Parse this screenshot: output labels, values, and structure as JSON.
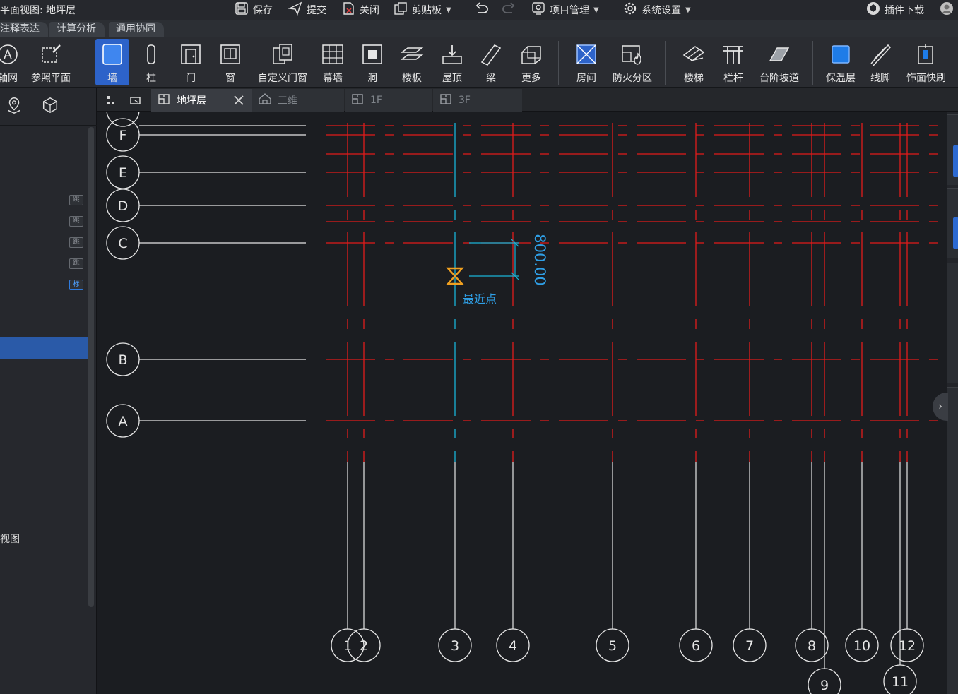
{
  "titlebar": {
    "title": "平面视图: 地坪层",
    "actions": [
      {
        "label": "保存",
        "icon": "save-icon"
      },
      {
        "label": "提交",
        "icon": "submit-icon"
      },
      {
        "label": "关闭",
        "icon": "close-file-icon"
      },
      {
        "label": "剪贴板",
        "icon": "clipboard-icon"
      },
      {
        "label": "项目管理",
        "icon": "project-settings-icon"
      },
      {
        "label": "系统设置",
        "icon": "system-settings-icon"
      },
      {
        "label": "插件下载",
        "icon": "plugin-download-icon"
      }
    ]
  },
  "ribbon_tabs": [
    "注释表达",
    "计算分析",
    "通用协同"
  ],
  "ribbon_tools": [
    {
      "label": "轴网",
      "icon": "axis-grid-icon"
    },
    {
      "label": "参照平面",
      "icon": "reference-plane-icon"
    },
    {
      "label": "墙",
      "icon": "wall-icon",
      "active": true
    },
    {
      "label": "柱",
      "icon": "column-icon"
    },
    {
      "label": "门",
      "icon": "door-icon"
    },
    {
      "label": "窗",
      "icon": "window-icon"
    },
    {
      "label": "自定义门窗",
      "icon": "custom-door-window-icon"
    },
    {
      "label": "幕墙",
      "icon": "curtain-wall-icon"
    },
    {
      "label": "洞",
      "icon": "opening-icon"
    },
    {
      "label": "楼板",
      "icon": "slab-icon"
    },
    {
      "label": "屋顶",
      "icon": "roof-icon"
    },
    {
      "label": "梁",
      "icon": "beam-icon"
    },
    {
      "label": "更多",
      "icon": "more-icon"
    },
    {
      "label": "房间",
      "icon": "room-icon"
    },
    {
      "label": "防火分区",
      "icon": "fire-zone-icon"
    },
    {
      "label": "楼梯",
      "icon": "stair-icon"
    },
    {
      "label": "栏杆",
      "icon": "railing-icon"
    },
    {
      "label": "台阶坡道",
      "icon": "ramp-icon"
    },
    {
      "label": "保温层",
      "icon": "insulation-icon"
    },
    {
      "label": "线脚",
      "icon": "molding-icon"
    },
    {
      "label": "饰面快刷",
      "icon": "finish-brush-icon"
    }
  ],
  "left_panel": {
    "chips": [
      "跳",
      "跳",
      "跳",
      "跳",
      "标"
    ],
    "view_label": "视图"
  },
  "doc_tabs": [
    {
      "label": "地坪层",
      "active": true
    },
    {
      "label": "三维",
      "active": false
    },
    {
      "label": "1F",
      "active": false
    },
    {
      "label": "3F",
      "active": false
    }
  ],
  "canvas": {
    "row_axes": [
      "F",
      "E",
      "D",
      "C",
      "B",
      "A"
    ],
    "column_axes": [
      "1",
      "2",
      "3",
      "4",
      "5",
      "6",
      "7",
      "8",
      "9",
      "10",
      "11",
      "12"
    ],
    "dimension_value": "800.00",
    "snap_label": "最近点",
    "colors": {
      "grid_red": "#e21b1b",
      "axis_white": "#e6e6e6",
      "accent_cyan": "#19b4d8",
      "snap_orange": "#f0a020",
      "dimension_blue": "#2f9fe6"
    }
  }
}
